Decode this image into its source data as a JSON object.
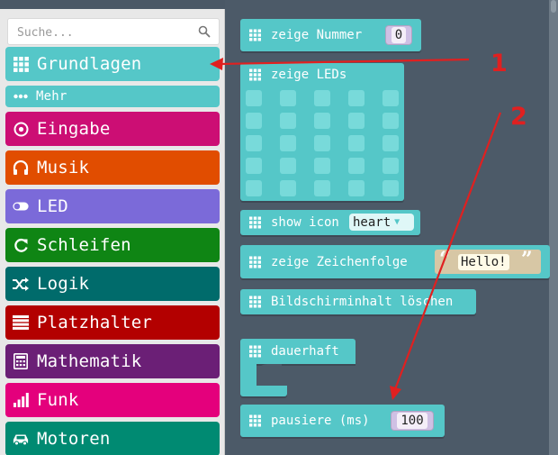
{
  "search": {
    "placeholder": "Suche..."
  },
  "categories": [
    {
      "label": "Grundlagen",
      "icon": "grid-icon",
      "color": "#55c7c8"
    },
    {
      "label": "Mehr",
      "icon": "dots-icon",
      "color": "#55c7c8"
    },
    {
      "label": "Eingabe",
      "icon": "target-icon",
      "color": "#cc0e74"
    },
    {
      "label": "Musik",
      "icon": "headphones-icon",
      "color": "#e14d00"
    },
    {
      "label": "LED",
      "icon": "toggle-icon",
      "color": "#7b6ad9"
    },
    {
      "label": "Schleifen",
      "icon": "refresh-icon",
      "color": "#0f8514"
    },
    {
      "label": "Logik",
      "icon": "shuffle-icon",
      "color": "#006b6b"
    },
    {
      "label": "Platzhalter",
      "icon": "list-icon",
      "color": "#b30000"
    },
    {
      "label": "Mathematik",
      "icon": "calculator-icon",
      "color": "#6b1f76"
    },
    {
      "label": "Funk",
      "icon": "signal-icon",
      "color": "#e4007c"
    },
    {
      "label": "Motoren",
      "icon": "car-icon",
      "color": "#008a72"
    }
  ],
  "blocks": {
    "show_number": {
      "label": "zeige Nummer",
      "value": "0"
    },
    "show_leds": {
      "label": "zeige LEDs"
    },
    "show_icon": {
      "label": "show icon",
      "value": "heart"
    },
    "show_string": {
      "label": "zeige Zeichenfolge",
      "value": "Hello!"
    },
    "clear_screen": {
      "label": "Bildschirminhalt löschen"
    },
    "forever": {
      "label": "dauerhaft"
    },
    "pause": {
      "label": "pausiere (ms)",
      "value": "100"
    }
  },
  "annotations": {
    "marker_1": "1",
    "marker_2": "2"
  }
}
